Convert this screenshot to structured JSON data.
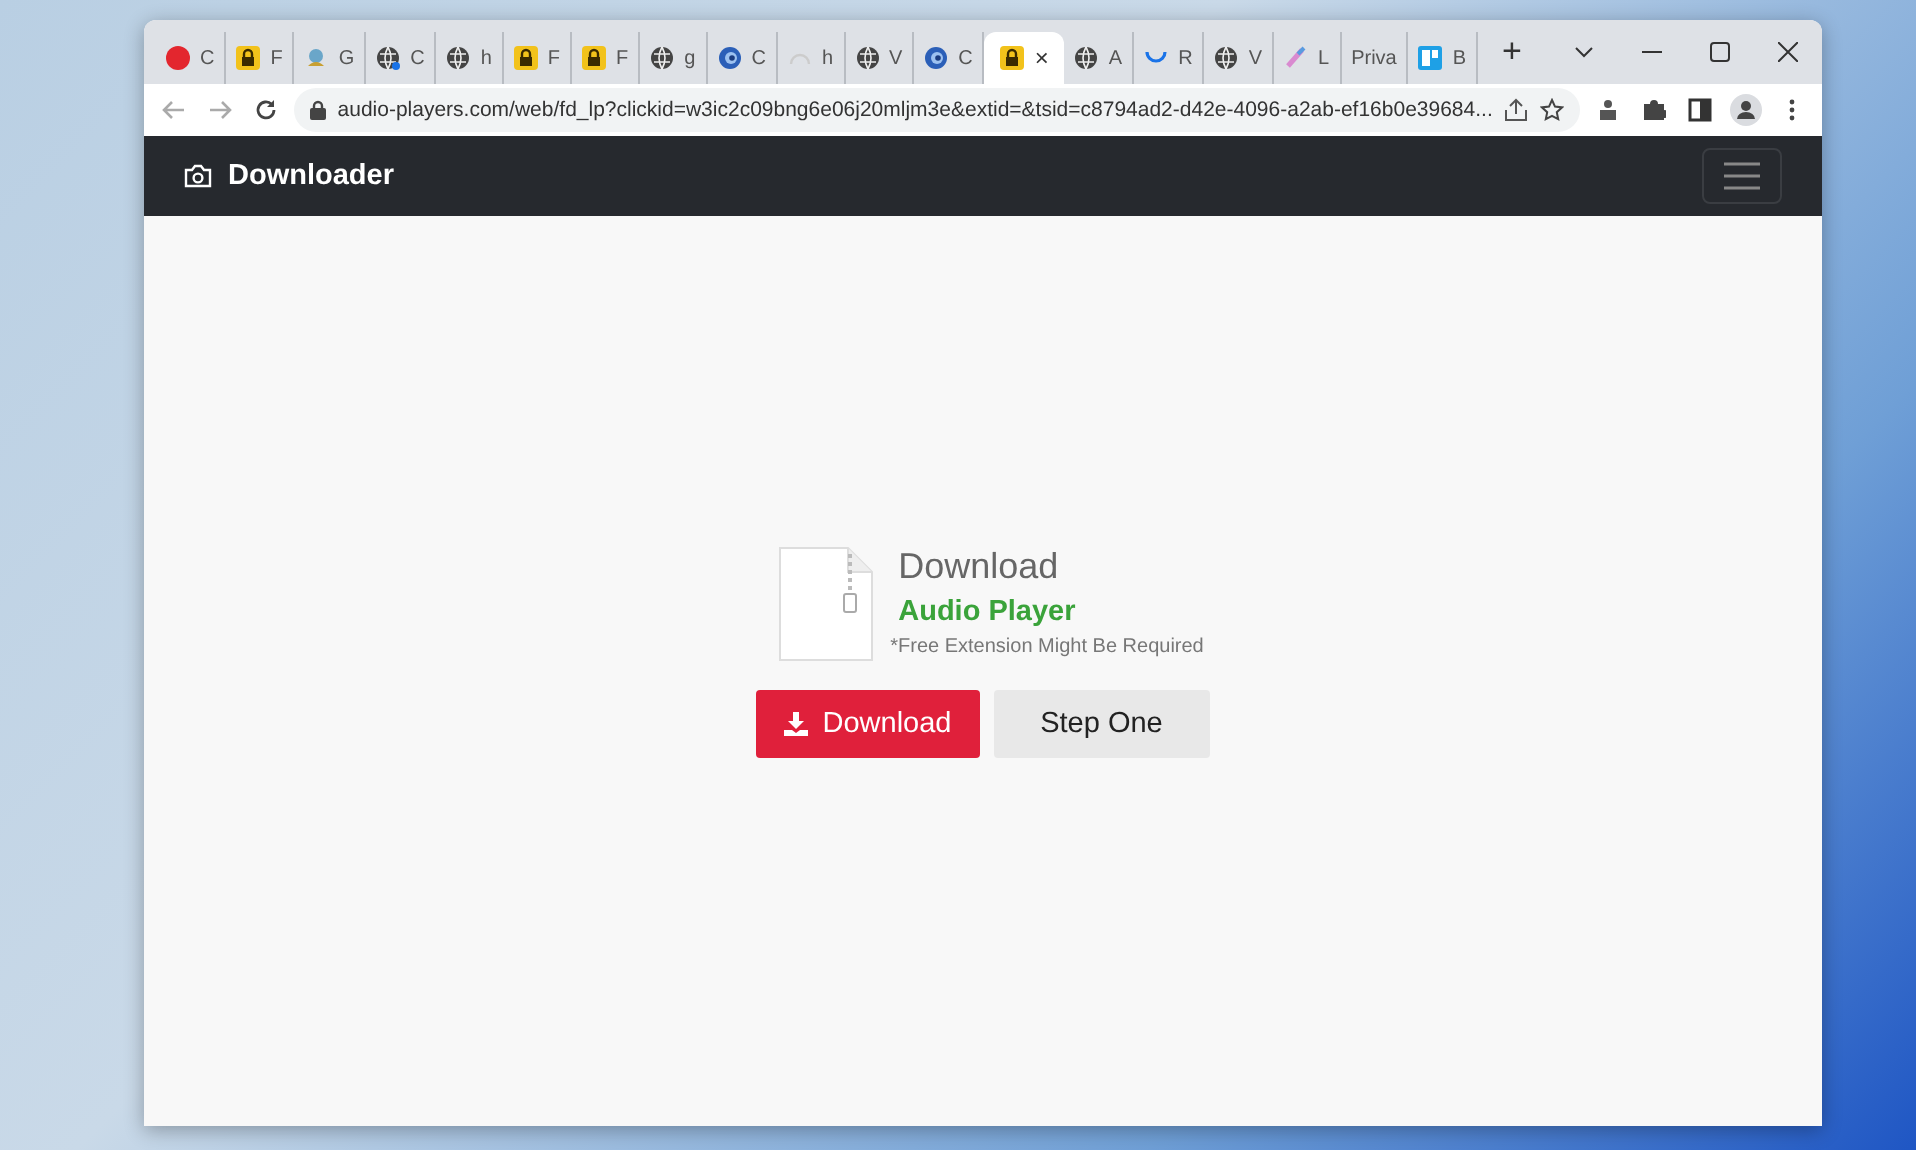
{
  "tabs": [
    {
      "kind": "circle",
      "label": "C",
      "selected": false
    },
    {
      "kind": "lock",
      "label": "F",
      "selected": false
    },
    {
      "kind": "bird",
      "label": "G",
      "selected": false
    },
    {
      "kind": "globe-dot",
      "label": "C",
      "selected": false
    },
    {
      "kind": "globe",
      "label": "h",
      "selected": false
    },
    {
      "kind": "lock",
      "label": "F",
      "selected": false
    },
    {
      "kind": "lock",
      "label": "F",
      "selected": false
    },
    {
      "kind": "globe",
      "label": "g",
      "selected": false
    },
    {
      "kind": "swirl",
      "label": "C",
      "selected": false
    },
    {
      "kind": "spinner-grey",
      "label": "h",
      "selected": false
    },
    {
      "kind": "globe",
      "label": "V",
      "selected": false
    },
    {
      "kind": "swirl",
      "label": "C",
      "selected": false
    },
    {
      "kind": "lock",
      "close": "×",
      "selected": true
    },
    {
      "kind": "globe",
      "label": "A",
      "selected": false
    },
    {
      "kind": "spinner",
      "label": "R",
      "selected": false
    },
    {
      "kind": "globe",
      "label": "V",
      "selected": false
    },
    {
      "kind": "pen",
      "label": "L",
      "selected": false
    },
    {
      "kind": "text",
      "label": "Priva",
      "selected": false
    },
    {
      "kind": "square",
      "label": "B",
      "selected": false
    }
  ],
  "new_tab": "+",
  "address_bar": {
    "url": "audio-players.com/web/fd_lp?clickid=w3ic2c09bng6e06j20mljm3e&extid=&tsid=c8794ad2-d42e-4096-a2ab-ef16b0e39684..."
  },
  "navbar": {
    "brand": "Downloader"
  },
  "card": {
    "heading": "Download",
    "product": "Audio Player",
    "note": "*Free Extension Might Be Required"
  },
  "buttons": [
    {
      "kind": "primary",
      "label": "Download"
    },
    {
      "kind": "secondary",
      "label": "Step One"
    }
  ]
}
